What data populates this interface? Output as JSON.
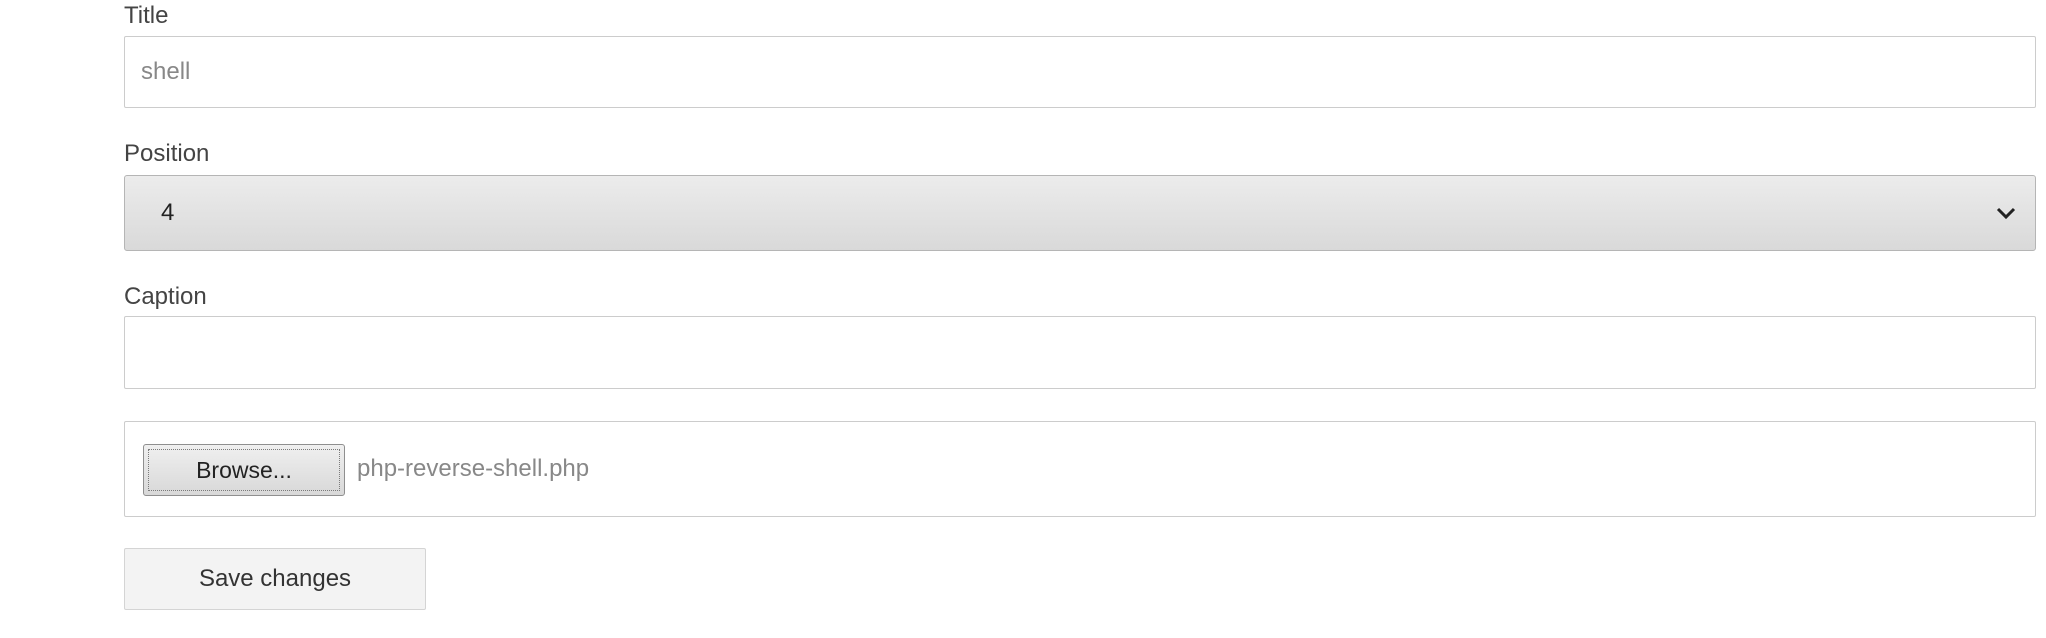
{
  "form": {
    "title": {
      "label": "Title",
      "value": "shell"
    },
    "position": {
      "label": "Position",
      "selected": "4",
      "icon": "chevron-down-icon"
    },
    "caption": {
      "label": "Caption",
      "value": ""
    },
    "file": {
      "browse_label": "Browse...",
      "file_name": "php-reverse-shell.php"
    },
    "save_label": "Save changes"
  }
}
